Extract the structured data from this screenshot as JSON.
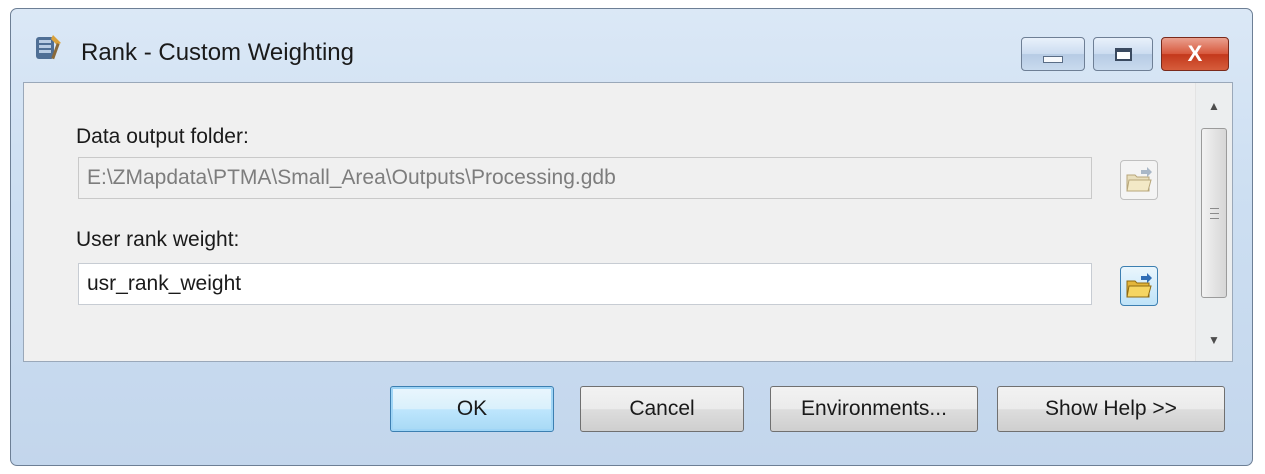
{
  "window": {
    "title": "Rank - Custom Weighting",
    "controls": {
      "minimize": "minimize",
      "maximize": "maximize",
      "close": "X"
    }
  },
  "form": {
    "output_folder": {
      "label": "Data output folder:",
      "value": "E:\\ZMapdata\\PTMA\\Small_Area\\Outputs\\Processing.gdb",
      "enabled": false
    },
    "rank_weight": {
      "label": "User rank weight:",
      "value": "usr_rank_weight",
      "enabled": true
    }
  },
  "buttons": {
    "ok": "OK",
    "cancel": "Cancel",
    "environments": "Environments...",
    "show_help": "Show Help >>"
  },
  "icons": {
    "app": "toolbox-tool-icon",
    "browse": "open-folder-icon"
  },
  "colors": {
    "close_button": "#c3381b",
    "default_button_border": "#3c7fb1",
    "window_frame": "#cddff2"
  }
}
